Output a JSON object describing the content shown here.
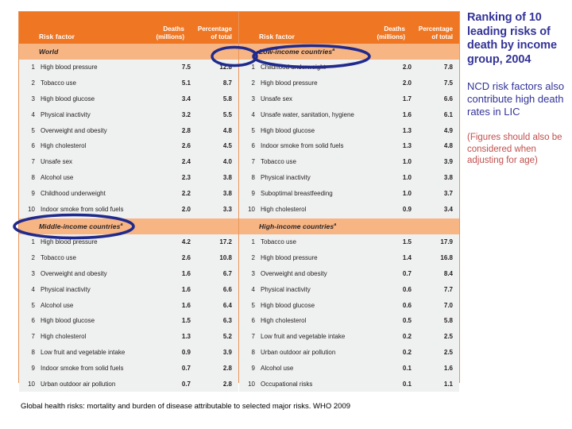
{
  "figure": {
    "columns": {
      "rank": "",
      "risk_factor": "Risk factor",
      "deaths": "Deaths\n(millions)",
      "deaths_line1": "Deaths",
      "deaths_line2": "(millions)",
      "percentage_line1": "Percentage",
      "percentage_line2": "of total"
    },
    "colors": {
      "header_orange": "#ef7622",
      "section_peach": "#f8b584",
      "row_gray": "#eff0f0",
      "border_orange": "#e8955a",
      "annotation_blue": "#1f2a8c",
      "title_blue": "#333399",
      "note_red": "#c0504d"
    },
    "sections": [
      {
        "id": "world",
        "title": "World",
        "superscript": "",
        "annotated": true,
        "rows": [
          {
            "rank": "1",
            "risk_factor": "High blood pressure",
            "deaths": "7.5",
            "percentage": "12.8"
          },
          {
            "rank": "2",
            "risk_factor": "Tobacco use",
            "deaths": "5.1",
            "percentage": "8.7"
          },
          {
            "rank": "3",
            "risk_factor": "High blood glucose",
            "deaths": "3.4",
            "percentage": "5.8"
          },
          {
            "rank": "4",
            "risk_factor": "Physical inactivity",
            "deaths": "3.2",
            "percentage": "5.5"
          },
          {
            "rank": "5",
            "risk_factor": "Overweight and obesity",
            "deaths": "2.8",
            "percentage": "4.8"
          },
          {
            "rank": "6",
            "risk_factor": "High cholesterol",
            "deaths": "2.6",
            "percentage": "4.5"
          },
          {
            "rank": "7",
            "risk_factor": "Unsafe sex",
            "deaths": "2.4",
            "percentage": "4.0"
          },
          {
            "rank": "8",
            "risk_factor": "Alcohol use",
            "deaths": "2.3",
            "percentage": "3.8"
          },
          {
            "rank": "9",
            "risk_factor": "Childhood underweight",
            "deaths": "2.2",
            "percentage": "3.8"
          },
          {
            "rank": "10",
            "risk_factor": "Indoor smoke from solid fuels",
            "deaths": "2.0",
            "percentage": "3.3"
          }
        ]
      },
      {
        "id": "middle-income",
        "title": "Middle-income countries",
        "superscript": "a",
        "annotated": true,
        "rows": [
          {
            "rank": "1",
            "risk_factor": "High blood pressure",
            "deaths": "4.2",
            "percentage": "17.2"
          },
          {
            "rank": "2",
            "risk_factor": "Tobacco use",
            "deaths": "2.6",
            "percentage": "10.8"
          },
          {
            "rank": "3",
            "risk_factor": "Overweight and obesity",
            "deaths": "1.6",
            "percentage": "6.7"
          },
          {
            "rank": "4",
            "risk_factor": "Physical inactivity",
            "deaths": "1.6",
            "percentage": "6.6"
          },
          {
            "rank": "5",
            "risk_factor": "Alcohol use",
            "deaths": "1.6",
            "percentage": "6.4"
          },
          {
            "rank": "6",
            "risk_factor": "High blood glucose",
            "deaths": "1.5",
            "percentage": "6.3"
          },
          {
            "rank": "7",
            "risk_factor": "High cholesterol",
            "deaths": "1.3",
            "percentage": "5.2"
          },
          {
            "rank": "8",
            "risk_factor": "Low fruit and vegetable intake",
            "deaths": "0.9",
            "percentage": "3.9"
          },
          {
            "rank": "9",
            "risk_factor": "Indoor smoke from solid fuels",
            "deaths": "0.7",
            "percentage": "2.8"
          },
          {
            "rank": "10",
            "risk_factor": "Urban outdoor air pollution",
            "deaths": "0.7",
            "percentage": "2.8"
          }
        ]
      },
      {
        "id": "low-income",
        "title": "Low-income countries",
        "superscript": "a",
        "annotated": true,
        "rows": [
          {
            "rank": "1",
            "risk_factor": "Childhood underweight",
            "deaths": "2.0",
            "percentage": "7.8"
          },
          {
            "rank": "2",
            "risk_factor": "High blood pressure",
            "deaths": "2.0",
            "percentage": "7.5"
          },
          {
            "rank": "3",
            "risk_factor": "Unsafe sex",
            "deaths": "1.7",
            "percentage": "6.6"
          },
          {
            "rank": "4",
            "risk_factor": "Unsafe water, sanitation, hygiene",
            "deaths": "1.6",
            "percentage": "6.1"
          },
          {
            "rank": "5",
            "risk_factor": "High blood glucose",
            "deaths": "1.3",
            "percentage": "4.9"
          },
          {
            "rank": "6",
            "risk_factor": "Indoor smoke from solid fuels",
            "deaths": "1.3",
            "percentage": "4.8"
          },
          {
            "rank": "7",
            "risk_factor": "Tobacco use",
            "deaths": "1.0",
            "percentage": "3.9"
          },
          {
            "rank": "8",
            "risk_factor": "Physical inactivity",
            "deaths": "1.0",
            "percentage": "3.8"
          },
          {
            "rank": "9",
            "risk_factor": "Suboptimal breastfeeding",
            "deaths": "1.0",
            "percentage": "3.7"
          },
          {
            "rank": "10",
            "risk_factor": "High cholesterol",
            "deaths": "0.9",
            "percentage": "3.4"
          }
        ]
      },
      {
        "id": "high-income",
        "title": "High-income countries",
        "superscript": "a",
        "annotated": false,
        "rows": [
          {
            "rank": "1",
            "risk_factor": "Tobacco use",
            "deaths": "1.5",
            "percentage": "17.9"
          },
          {
            "rank": "2",
            "risk_factor": "High blood pressure",
            "deaths": "1.4",
            "percentage": "16.8"
          },
          {
            "rank": "3",
            "risk_factor": "Overweight and obesity",
            "deaths": "0.7",
            "percentage": "8.4"
          },
          {
            "rank": "4",
            "risk_factor": "Physical inactivity",
            "deaths": "0.6",
            "percentage": "7.7"
          },
          {
            "rank": "5",
            "risk_factor": "High blood glucose",
            "deaths": "0.6",
            "percentage": "7.0"
          },
          {
            "rank": "6",
            "risk_factor": "High cholesterol",
            "deaths": "0.5",
            "percentage": "5.8"
          },
          {
            "rank": "7",
            "risk_factor": "Low fruit and vegetable intake",
            "deaths": "0.2",
            "percentage": "2.5"
          },
          {
            "rank": "8",
            "risk_factor": "Urban outdoor air pollution",
            "deaths": "0.2",
            "percentage": "2.5"
          },
          {
            "rank": "9",
            "risk_factor": "Alcohol use",
            "deaths": "0.1",
            "percentage": "1.6"
          },
          {
            "rank": "10",
            "risk_factor": "Occupational risks",
            "deaths": "0.1",
            "percentage": "1.1"
          }
        ]
      }
    ]
  },
  "side_panel": {
    "title": "Ranking of 10 leading risks of death by income group, 2004",
    "body": "NCD risk factors also contribute high death rates in LIC",
    "note": "(Figures should also be considered when adjusting for age)"
  },
  "source_caption": "Global health risks: mortality and burden of disease attributable to selected major risks. WHO 2009"
}
